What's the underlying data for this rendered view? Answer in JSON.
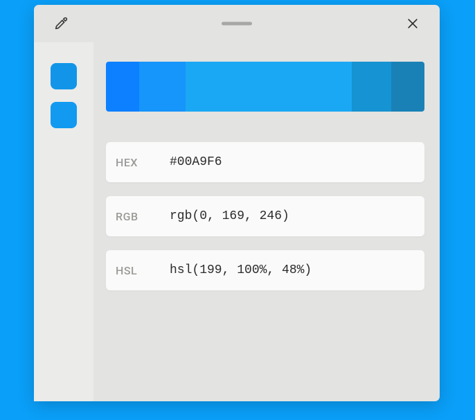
{
  "sidebar": {
    "swatches": [
      {
        "color": "#1295E8"
      },
      {
        "color": "#129AF0"
      }
    ]
  },
  "palette": {
    "segments": [
      {
        "color": "#0D80FF",
        "flex": 1.0
      },
      {
        "color": "#1695FB",
        "flex": 1.4
      },
      {
        "color": "#1AA8F4",
        "flex": 5.0
      },
      {
        "color": "#1693D2",
        "flex": 1.2
      },
      {
        "color": "#1A81B6",
        "flex": 1.0
      }
    ]
  },
  "values": {
    "hex": {
      "label": "HEX",
      "value": "#00A9F6"
    },
    "rgb": {
      "label": "RGB",
      "value": "rgb(0, 169, 246)"
    },
    "hsl": {
      "label": "HSL",
      "value": "hsl(199, 100%, 48%)"
    }
  }
}
